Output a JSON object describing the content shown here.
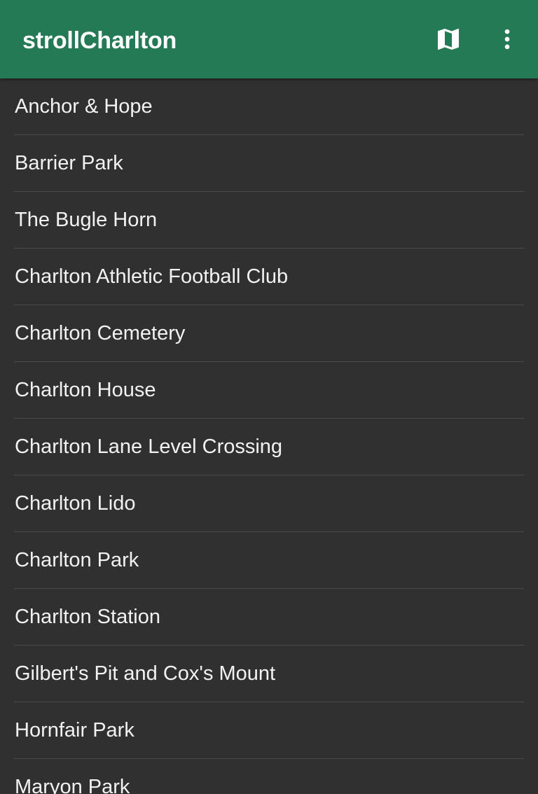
{
  "appbar": {
    "title": "strollCharlton",
    "actions": [
      {
        "name": "map",
        "icon": "map-icon"
      },
      {
        "name": "more",
        "icon": "more-vert-icon"
      }
    ],
    "color": "#237a55"
  },
  "list": {
    "background": "#303030",
    "items": [
      {
        "label": "Anchor & Hope"
      },
      {
        "label": "Barrier Park"
      },
      {
        "label": "The Bugle Horn"
      },
      {
        "label": "Charlton Athletic Football Club"
      },
      {
        "label": "Charlton Cemetery"
      },
      {
        "label": "Charlton House"
      },
      {
        "label": "Charlton Lane Level Crossing"
      },
      {
        "label": "Charlton Lido"
      },
      {
        "label": "Charlton Park"
      },
      {
        "label": "Charlton Station"
      },
      {
        "label": "Gilbert's Pit and Cox's Mount"
      },
      {
        "label": "Hornfair Park"
      },
      {
        "label": "Maryon Park"
      }
    ]
  }
}
